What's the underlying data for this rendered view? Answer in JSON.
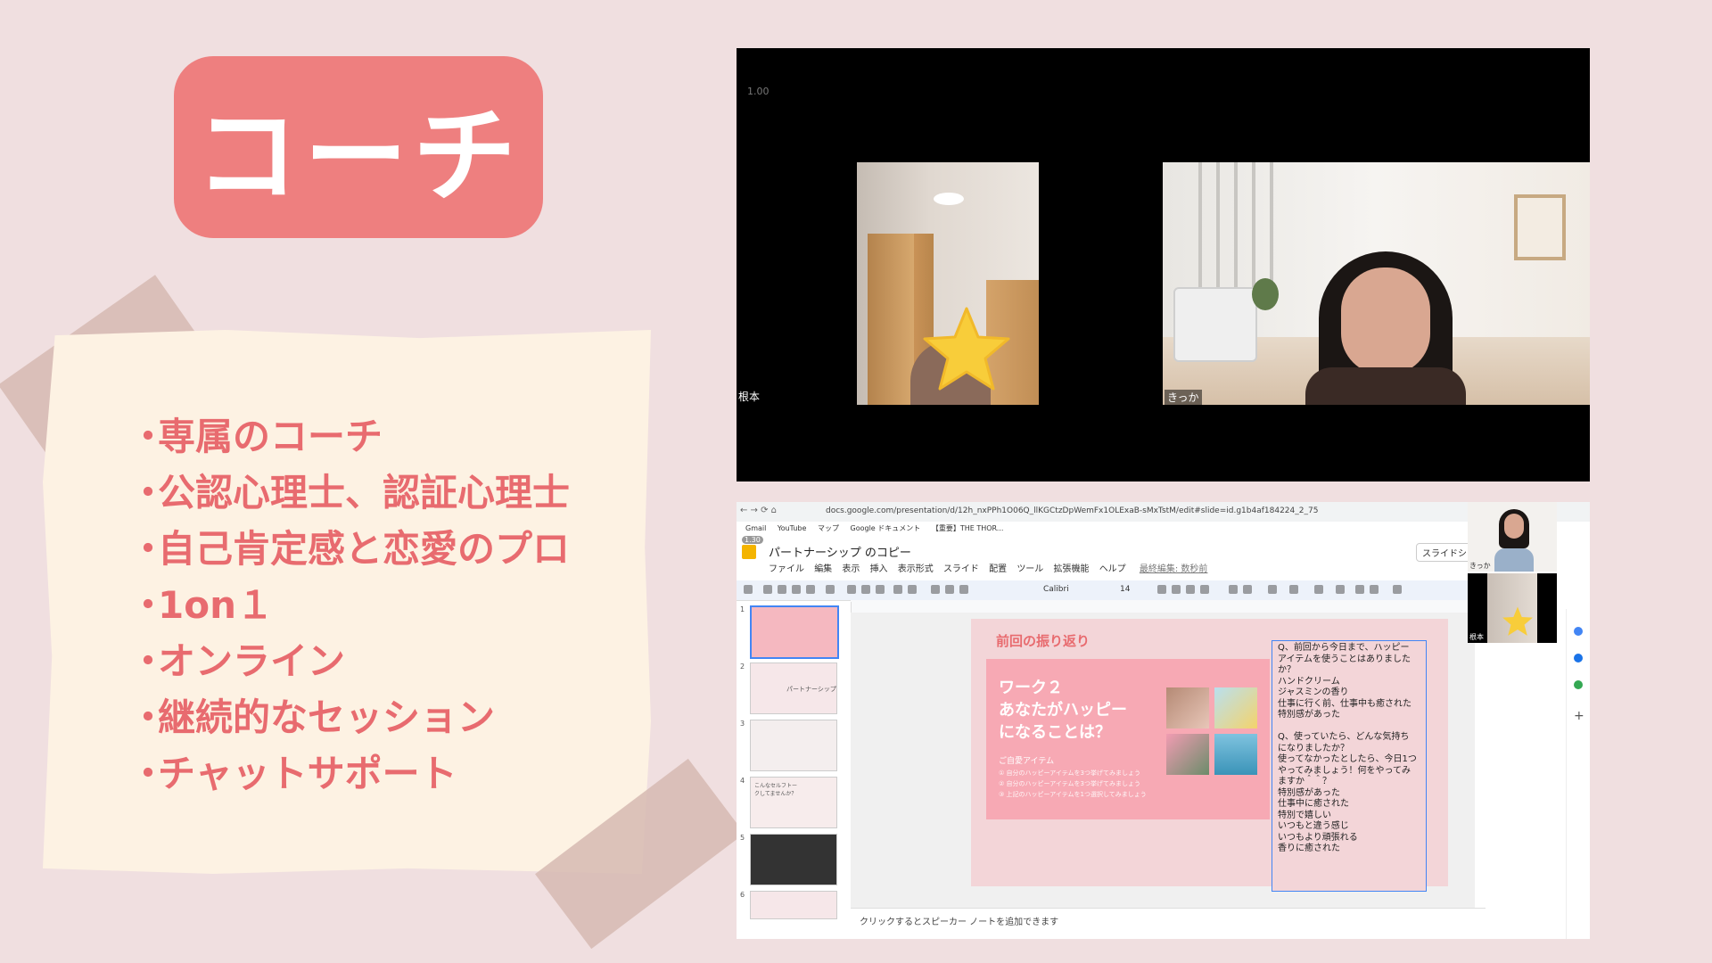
{
  "title": "コーチ",
  "bullets": [
    "専属のコーチ",
    "公認心理士、認証心理士",
    "自己肯定感と恋愛のプロ",
    "1on１",
    "オンライン",
    "継続的なセッション",
    "チャットサポート"
  ],
  "bullet_char": "・",
  "video_call": {
    "zoom_level": "1.00",
    "participant_left": "根本",
    "participant_right": "きっか"
  },
  "screen_share": {
    "url": "docs.google.com/presentation/d/12h_nxPPh1O06Q_llKGCtzDpWemFx1OLExaB-sMxTstM/edit#slide=id.g1b4af184224_2_75",
    "bookmarks": [
      "Gmail",
      "YouTube",
      "マップ",
      "Google ドキュメント",
      "【重要】THE THOR..."
    ],
    "doc_title": "パートナーシップ のコピー",
    "zoom_badge": "1.30",
    "menu": [
      "ファイル",
      "編集",
      "表示",
      "挿入",
      "表示形式",
      "スライド",
      "配置",
      "ツール",
      "拡張機能",
      "ヘルプ"
    ],
    "last_edit": "最終編集: 数秒前",
    "share_button": "スライドシ",
    "font": "Calibri",
    "font_size": "14",
    "thumbnail_numbers": [
      "1",
      "2",
      "3",
      "4",
      "5",
      "6"
    ],
    "thumb2_label": "パートナーシップ",
    "thumb4_label": "こんなセルフトークしてませんか？",
    "slide": {
      "heading": "前回の振り返り",
      "card_title": "ワーク２\nあなたがハッピー\nになることは？",
      "card_subtitle": "ご自愛アイテム",
      "card_lines": [
        "① 自分のハッピーアイテムを3つ挙げてみましょう",
        "② 自分のハッピーアイテムを3つ挙げてみましょう",
        "③ 上記のハッピーアイテムを1つ選択してみましょう"
      ],
      "textbox": "Q、前回から今日まで、ハッピー\nアイテムを使うことはありました\nか？\nハンドクリーム\nジャスミンの香り\n仕事に行く前、仕事中も癒された\n特別感があった\n\nQ、使っていたら、どんな気持ち\nになりましたか？\n使ってなかったとしたら、今日1つ\nやってみましょう！何をやってみ\nますか＾＾？\n特別感があった\n仕事中に癒された\n特別で嬉しい\nいつもと違う感じ\nいつもより頑張れる\n香りに癒された"
    },
    "speaker_notes_placeholder": "クリックするとスピーカー ノートを追加できます",
    "mini_participant_top": "きっか",
    "mini_participant_bottom": "根本"
  },
  "colors": {
    "background": "#f0dfe0",
    "accent": "#ee7f7f",
    "bullet_text": "#e86b6f",
    "note_paper": "#fdf2e3",
    "tape": "#d6bab2"
  }
}
